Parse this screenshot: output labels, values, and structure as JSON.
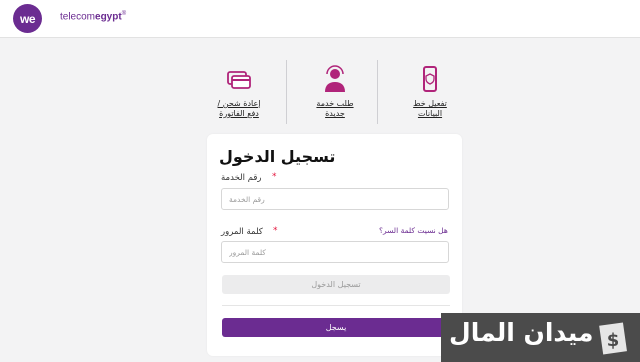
{
  "header": {
    "logo_text": "we",
    "brand_light": "telecom",
    "brand_bold": "egypt",
    "brand_mark": "®"
  },
  "services": [
    {
      "label_line1": "تفعيل خط",
      "label_line2": "البيانات",
      "icon": "phone-shield-icon"
    },
    {
      "label_line1": "طلب خدمة",
      "label_line2": "جديدة",
      "icon": "person-agent-icon"
    },
    {
      "label_line1": "إعادة شحن /",
      "label_line2": "دفع الفاتورة",
      "icon": "cards-icon"
    }
  ],
  "login": {
    "title": "تسجيل الدخول",
    "service_label": "رقم الخدمة",
    "service_placeholder": "رقم الخدمة",
    "password_label": "كلمة المرور",
    "password_placeholder": "كلمة المرور",
    "forgot_link": "هل نسيت كلمة السر؟",
    "required_mark": "*",
    "login_button": "تسجيل الدخول",
    "register_button": "يسجل"
  },
  "watermark": {
    "text": "ميدان المال",
    "symbol": "$"
  },
  "colors": {
    "brand": "#6b2c91",
    "required": "#e4173e",
    "background": "#f3f3f4"
  }
}
